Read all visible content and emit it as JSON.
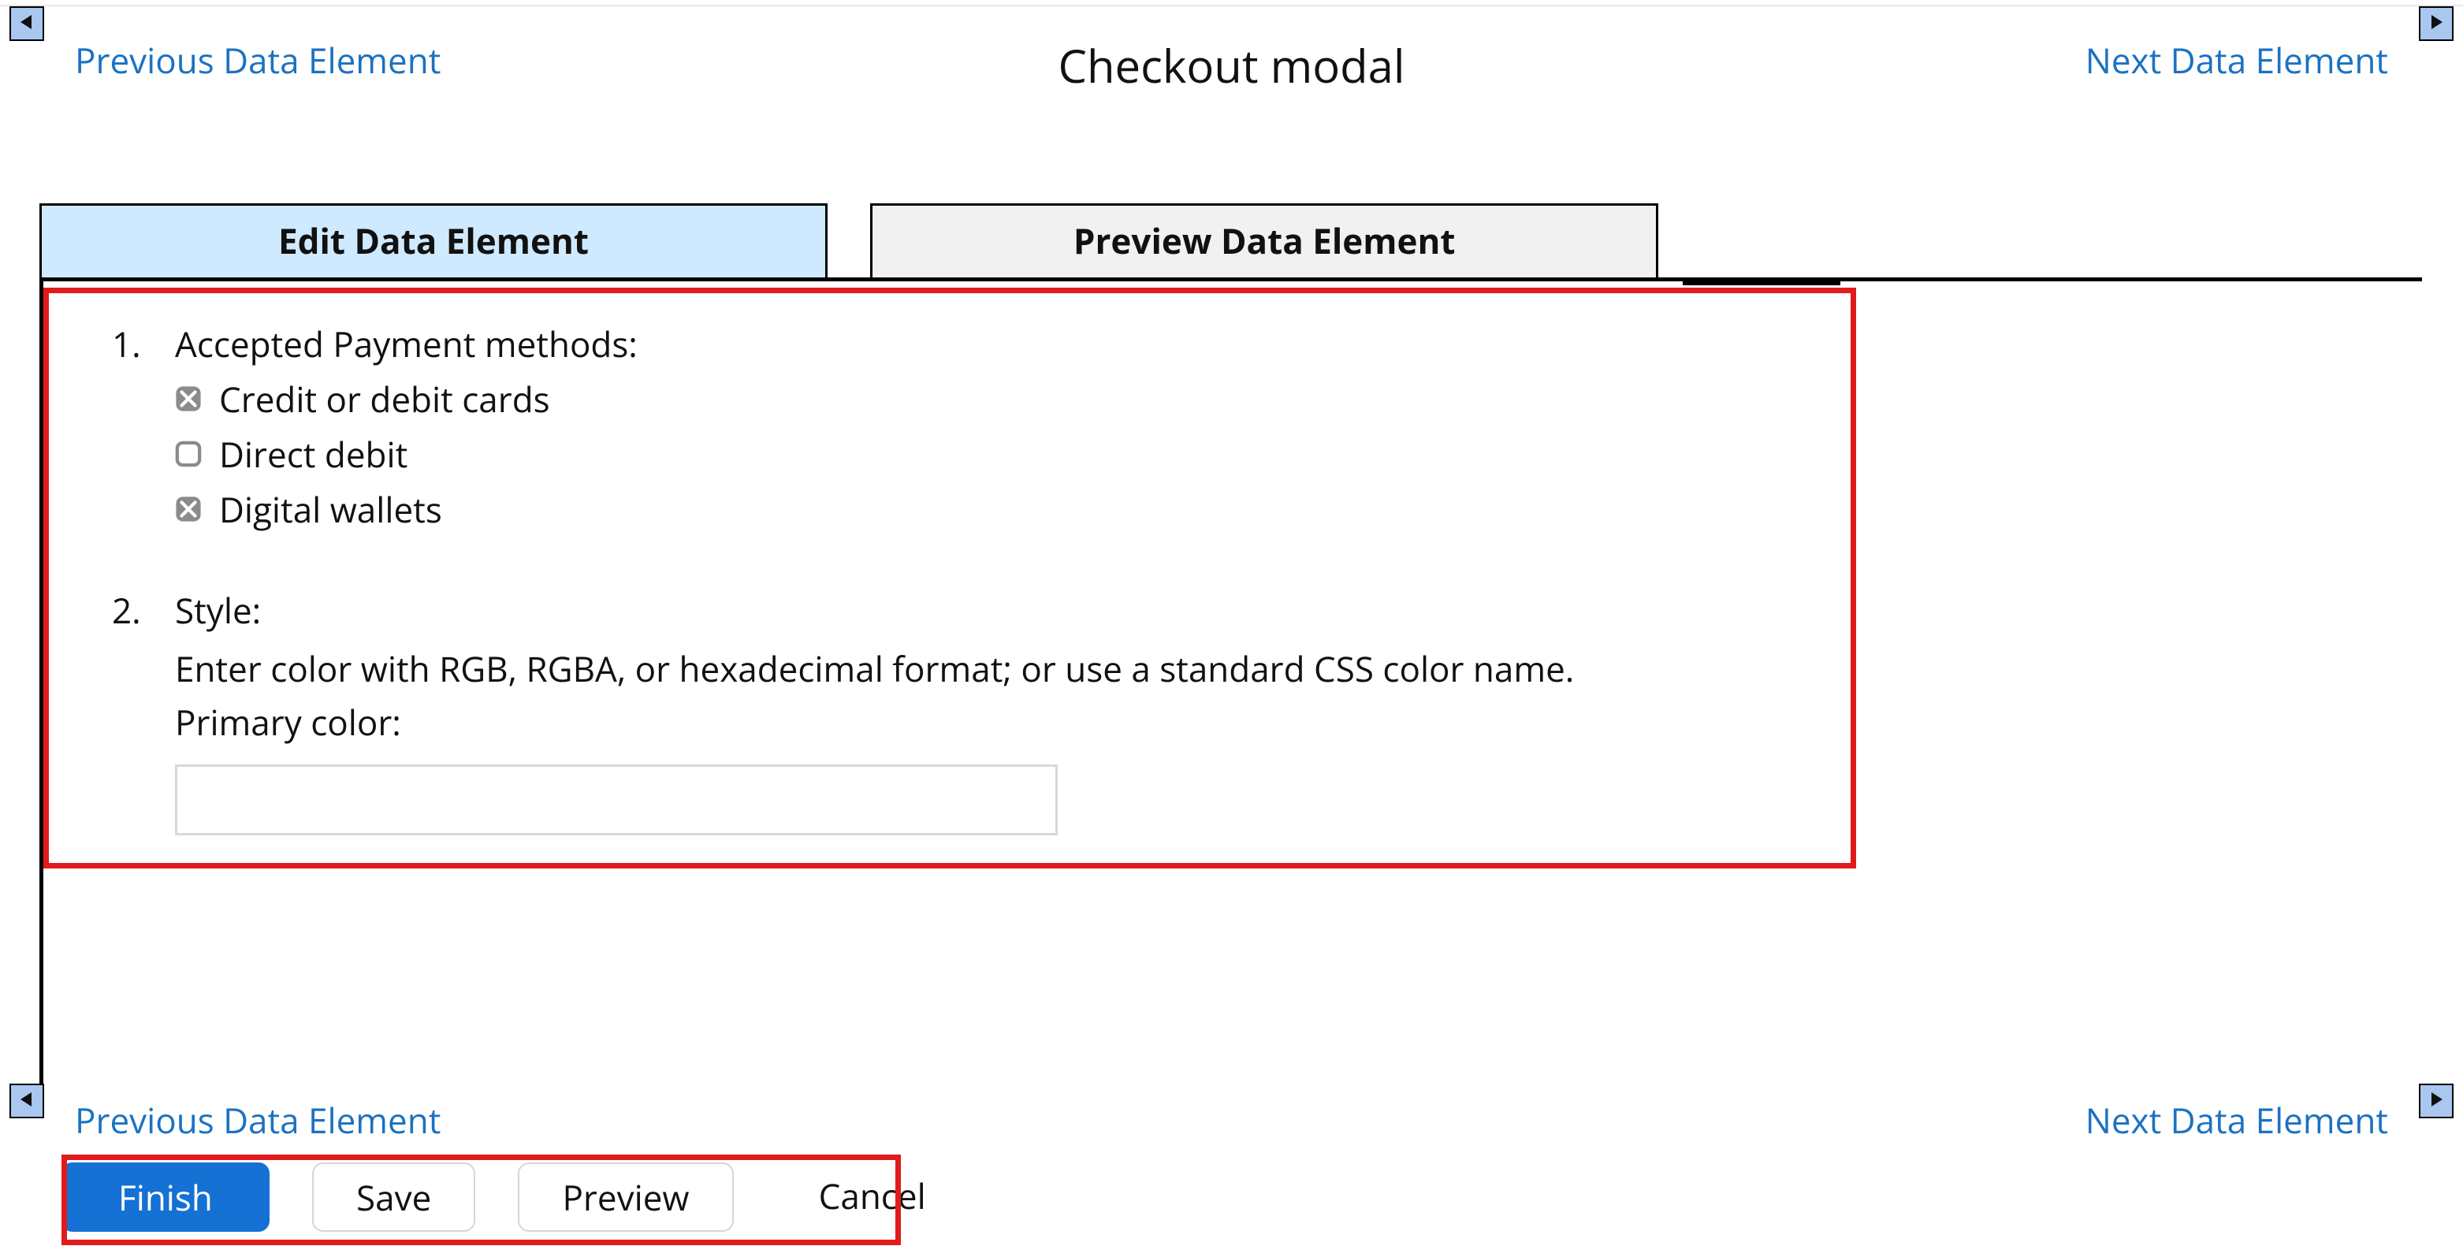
{
  "nav": {
    "prev_label": "Previous Data Element",
    "next_label": "Next Data Element"
  },
  "title": "Checkout modal",
  "tabs": {
    "edit_label": "Edit Data Element",
    "preview_label": "Preview Data Element"
  },
  "form": {
    "item1": {
      "number": "1.",
      "heading": "Accepted Payment methods:",
      "options": {
        "opt1": {
          "label": "Credit or debit cards",
          "checked": true
        },
        "opt2": {
          "label": "Direct debit",
          "checked": false
        },
        "opt3": {
          "label": "Digital wallets",
          "checked": true
        }
      }
    },
    "item2": {
      "number": "2.",
      "heading": "Style:",
      "hint": "Enter color with RGB, RGBA, or hexadecimal format; or use a standard CSS color name.",
      "color_label": "Primary color:",
      "color_value": ""
    }
  },
  "actions": {
    "finish": "Finish",
    "save": "Save",
    "preview": "Preview",
    "cancel": "Cancel"
  }
}
